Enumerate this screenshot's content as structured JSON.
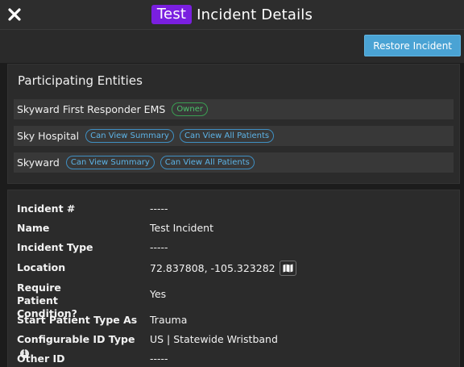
{
  "header": {
    "badge": "Test",
    "title": "Incident Details"
  },
  "toolbar": {
    "restore_label": "Restore Incident"
  },
  "entities": {
    "title": "Participating Entities",
    "items": [
      {
        "name": "Skyward First Responder EMS",
        "tags": [
          "Owner"
        ]
      },
      {
        "name": "Sky Hospital",
        "tags": [
          "Can View Summary",
          "Can View All Patients"
        ]
      },
      {
        "name": "Skyward",
        "tags": [
          "Can View Summary",
          "Can View All Patients"
        ]
      }
    ]
  },
  "details": {
    "incident_number": {
      "label": "Incident #",
      "value": "-----"
    },
    "name": {
      "label": "Name",
      "value": "Test Incident"
    },
    "incident_type": {
      "label": "Incident Type",
      "value": "-----"
    },
    "location": {
      "label": "Location",
      "value": "72.837808, -105.323282"
    },
    "require_condition": {
      "label": "Require Patient Condition?",
      "value": "Yes"
    },
    "start_patient_type": {
      "label": "Start Patient Type As",
      "value": "Trauma"
    },
    "configurable_id_type": {
      "label": "Configurable ID Type",
      "value": "US | Statewide Wristband"
    },
    "other_id": {
      "label": "Other ID",
      "value": "-----"
    }
  },
  "icons": {
    "close": "close-icon",
    "map": "map-icon",
    "info": "info-icon"
  },
  "colors": {
    "test_badge": "#7a1fe0",
    "restore_button": "#4aa3d4",
    "tag_blue": "#5db3e6",
    "tag_green": "#4cc26b"
  }
}
